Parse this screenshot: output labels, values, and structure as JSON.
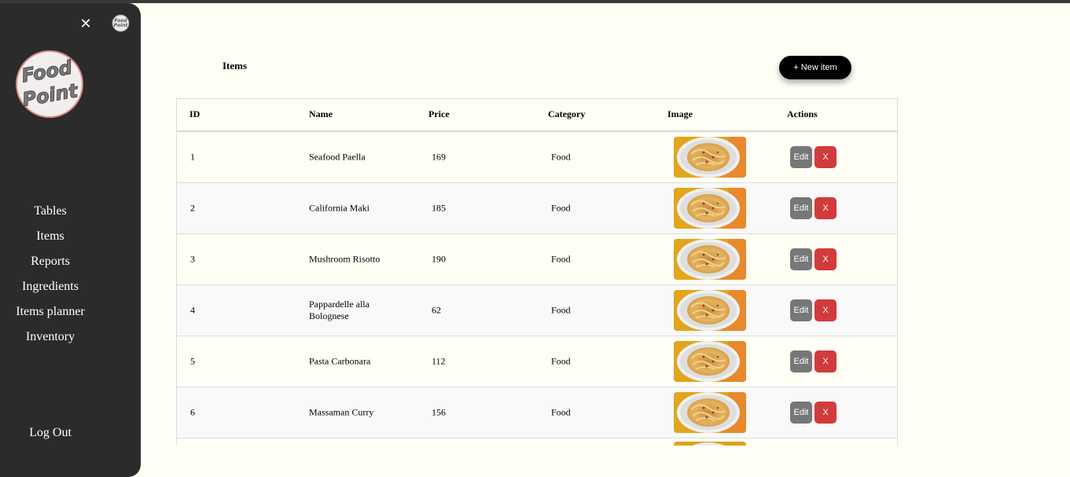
{
  "sidebar": {
    "close_symbol": "✕",
    "nav": [
      "Tables",
      "Items",
      "Reports",
      "Ingredients",
      "Items planner",
      "Inventory"
    ],
    "logout": "Log Out",
    "logo_text_line1": "Food",
    "logo_text_line2": "Point"
  },
  "main": {
    "title": "Items",
    "new_item_label": "+ New item",
    "columns": [
      "ID",
      "Name",
      "Price",
      "Category",
      "Image",
      "Actions"
    ],
    "rows": [
      {
        "id": "1",
        "name": "Seafood Paella",
        "price": "169",
        "category": "Food"
      },
      {
        "id": "2",
        "name": "California Maki",
        "price": "185",
        "category": "Food"
      },
      {
        "id": "3",
        "name": "Mushroom Risotto",
        "price": "190",
        "category": "Food"
      },
      {
        "id": "4",
        "name": "Pappardelle alla Bolognese",
        "price": "62",
        "category": "Food"
      },
      {
        "id": "5",
        "name": "Pasta Carbonara",
        "price": "112",
        "category": "Food"
      },
      {
        "id": "6",
        "name": "Massaman Curry",
        "price": "156",
        "category": "Food"
      }
    ],
    "edit_label": "Edit",
    "delete_label": "X"
  },
  "colors": {
    "sidebar_bg": "#2b2b2b",
    "page_bg": "#fffff6",
    "delete_red": "#d13b3b",
    "edit_gray": "#777777"
  },
  "icons": {
    "close": "close-icon",
    "logo": "food-point-logo",
    "dish_image": "pasta-dish-image"
  }
}
